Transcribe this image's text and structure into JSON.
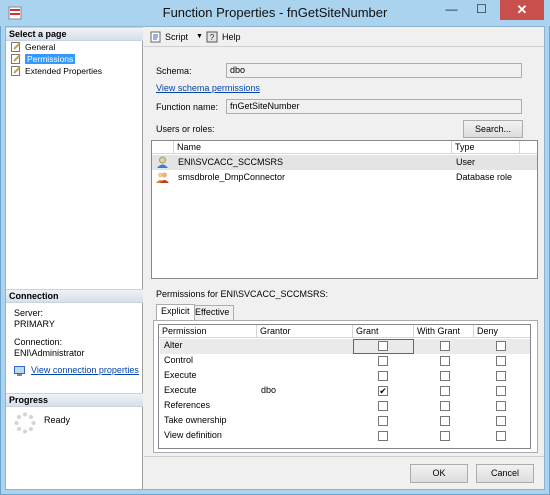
{
  "window": {
    "title": "Function Properties - fnGetSiteNumber",
    "minimize": "—",
    "maximize": "☐",
    "close": "✕"
  },
  "left": {
    "select_page_header": "Select a page",
    "pages": [
      {
        "label": "General",
        "selected": false
      },
      {
        "label": "Permissions",
        "selected": true
      },
      {
        "label": "Extended Properties",
        "selected": false
      }
    ],
    "connection_header": "Connection",
    "server_label": "Server:",
    "server_value": "PRIMARY",
    "connection_label": "Connection:",
    "connection_value": "ENI\\Administrator",
    "view_connection_link": "View connection properties",
    "progress_header": "Progress",
    "progress_status": "Ready"
  },
  "toolbar": {
    "script_label": "Script",
    "script_arrow": "▼",
    "help_label": "Help"
  },
  "form": {
    "schema_label": "Schema:",
    "schema_value": "dbo",
    "view_schema_link": "View schema permissions",
    "function_name_label": "Function name:",
    "function_name_value": "fnGetSiteNumber",
    "users_roles_label": "Users or roles:",
    "search_button": "Search..."
  },
  "users_grid": {
    "headers": [
      "Name",
      "Type"
    ],
    "rows": [
      {
        "name": "ENI\\SVCACC_SCCMSRS",
        "type": "User",
        "selected": true
      },
      {
        "name": "smsdbrole_DmpConnector",
        "type": "Database role",
        "selected": false
      }
    ]
  },
  "permissions": {
    "for_label": "Permissions for ENI\\SVCACC_SCCMSRS:",
    "tabs": [
      {
        "label": "Explicit",
        "active": true
      },
      {
        "label": "Effective",
        "active": false
      }
    ],
    "headers": [
      "Permission",
      "Grantor",
      "Grant",
      "With Grant",
      "Deny"
    ],
    "rows": [
      {
        "permission": "Alter",
        "grantor": "",
        "grant": false,
        "with_grant": false,
        "deny": false
      },
      {
        "permission": "Control",
        "grantor": "",
        "grant": false,
        "with_grant": false,
        "deny": false
      },
      {
        "permission": "Execute",
        "grantor": "",
        "grant": false,
        "with_grant": false,
        "deny": false
      },
      {
        "permission": "Execute",
        "grantor": "dbo",
        "grant": true,
        "with_grant": false,
        "deny": false
      },
      {
        "permission": "References",
        "grantor": "",
        "grant": false,
        "with_grant": false,
        "deny": false
      },
      {
        "permission": "Take ownership",
        "grantor": "",
        "grant": false,
        "with_grant": false,
        "deny": false
      },
      {
        "permission": "View definition",
        "grantor": "",
        "grant": false,
        "with_grant": false,
        "deny": false
      }
    ]
  },
  "buttons": {
    "ok": "OK",
    "cancel": "Cancel"
  },
  "colors": {
    "frame": "#a9d3ee",
    "selection": "#3399ff",
    "close": "#c7504c",
    "link": "#0645ad"
  }
}
